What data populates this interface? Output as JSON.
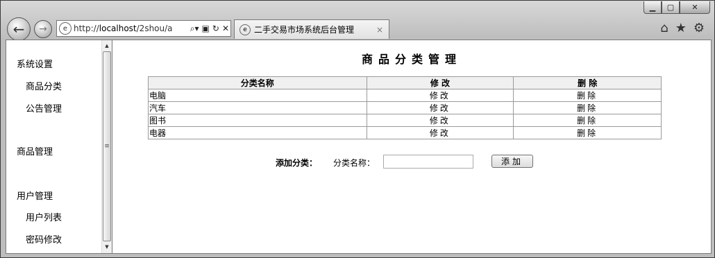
{
  "browser": {
    "address": {
      "prefix": "http://",
      "host": "localhost",
      "path": "/2shou/a"
    },
    "tab_title": "二手交易市场系统后台管理",
    "tab_close": "×"
  },
  "sidebar": {
    "groups": [
      {
        "label": "系统设置",
        "items": [
          "商品分类",
          "公告管理"
        ]
      },
      {
        "label": "商品管理",
        "items": []
      },
      {
        "label": "用户管理",
        "items": [
          "用户列表",
          "密码修改"
        ]
      }
    ]
  },
  "main": {
    "title": "商品分类管理",
    "table": {
      "headers": [
        "分类名称",
        "修 改",
        "删 除"
      ],
      "rows": [
        {
          "name": "电脑",
          "edit": "修改",
          "delete": "删除"
        },
        {
          "name": "汽车",
          "edit": "修改",
          "delete": "删除"
        },
        {
          "name": "图书",
          "edit": "修改",
          "delete": "删除"
        },
        {
          "name": "电器",
          "edit": "修改",
          "delete": "删除"
        }
      ]
    },
    "add_form": {
      "section_label": "添加分类：",
      "field_label": "分类名称：",
      "field_value": "",
      "button_label": "添加"
    }
  }
}
